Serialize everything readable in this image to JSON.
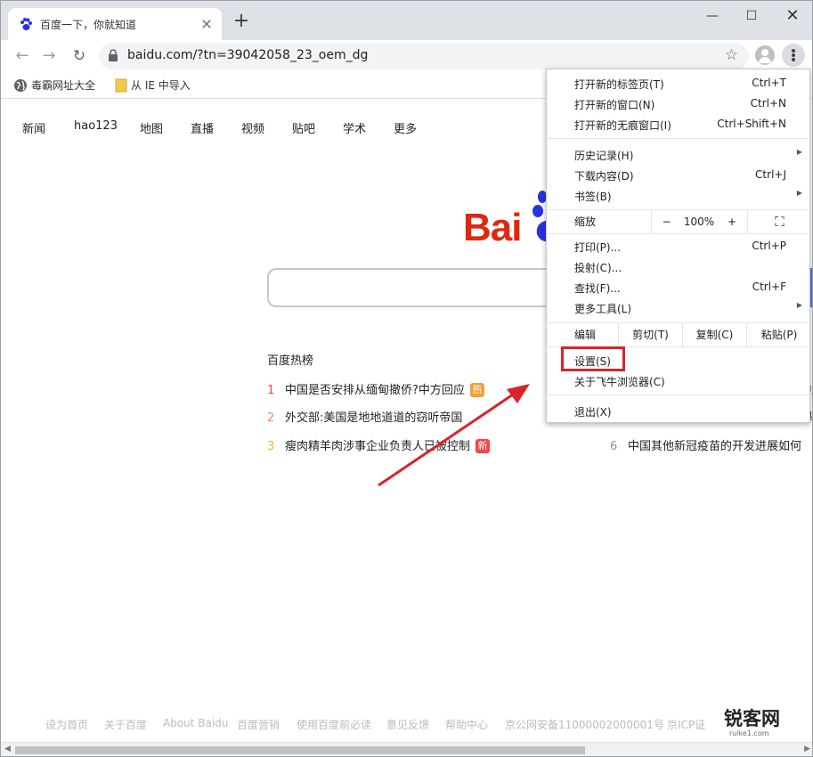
{
  "browser": {
    "tab": {
      "title": "百度一下，你就知道",
      "close_glyph": "×"
    },
    "new_tab_glyph": "+",
    "window_controls": {
      "minimize": "—",
      "maximize": "☐",
      "close": "✕"
    },
    "nav": {
      "back": "←",
      "forward": "→",
      "reload": "↻"
    },
    "url": "baidu.com/?tn=39042058_23_oem_dg",
    "star_glyph": "☆",
    "bookmarks": [
      {
        "label": "毒霸网址大全"
      },
      {
        "label": "从 IE 中导入"
      }
    ]
  },
  "page": {
    "topnav": [
      "新闻",
      "hao123",
      "地图",
      "直播",
      "视频",
      "贴吧",
      "学术",
      "更多"
    ],
    "logo_text": "Bai",
    "hot_title": "百度热榜",
    "hot_items": [
      {
        "num": "1",
        "text": "中国是否安排从缅甸撤侨?中方回应",
        "badge": "热",
        "num_color": "#f54545",
        "badge_color": "#f1a033"
      },
      {
        "num": "2",
        "text": "外交部:美国是地地道道的窃听帝国",
        "badge": "",
        "num_color": "#ff8547",
        "badge_color": ""
      },
      {
        "num": "3",
        "text": "瘦肉精羊肉涉事企业负责人已被控制",
        "badge": "新",
        "num_color": "#ffac38",
        "badge_color": "#f54545"
      }
    ],
    "hot_right": [
      {
        "num": "6",
        "text": "中国其他新冠疫苗的开发进展如何"
      }
    ],
    "hot_right_fragments": [
      "刂",
      "头"
    ],
    "footer": [
      "设为首页",
      "关于百度",
      "About Baidu",
      "百度营销",
      "使用百度前必读",
      "意见反馈",
      "帮助中心",
      "京公网安备11000002000001号",
      "京ICP证"
    ],
    "watermark": {
      "text": "锐客网",
      "sub": "ruike1.com"
    }
  },
  "menu": {
    "items_group1": [
      {
        "label": "打开新的标签页(T)",
        "shortcut": "Ctrl+T"
      },
      {
        "label": "打开新的窗口(N)",
        "shortcut": "Ctrl+N"
      },
      {
        "label": "打开新的无痕窗口(I)",
        "shortcut": "Ctrl+Shift+N"
      }
    ],
    "items_group2": [
      {
        "label": "历史记录(H)",
        "shortcut": "",
        "submenu": true
      },
      {
        "label": "下载内容(D)",
        "shortcut": "Ctrl+J"
      },
      {
        "label": "书签(B)",
        "shortcut": "",
        "submenu": true
      }
    ],
    "zoom": {
      "label": "缩放",
      "minus": "−",
      "value": "100%",
      "plus": "+",
      "fullscreen": "⛶"
    },
    "items_group3": [
      {
        "label": "打印(P)...",
        "shortcut": "Ctrl+P"
      },
      {
        "label": "投射(C)...",
        "shortcut": ""
      },
      {
        "label": "查找(F)...",
        "shortcut": "Ctrl+F"
      },
      {
        "label": "更多工具(L)",
        "shortcut": "",
        "submenu": true
      }
    ],
    "edit": {
      "label": "编辑",
      "cut": "剪切(T)",
      "copy": "复制(C)",
      "paste": "粘贴(P)"
    },
    "items_group4": [
      {
        "label": "设置(S)",
        "shortcut": ""
      },
      {
        "label": "关于飞牛浏览器(C)",
        "shortcut": ""
      }
    ],
    "exit": {
      "label": "退出(X)"
    },
    "highlight_color": "#d8232a"
  }
}
